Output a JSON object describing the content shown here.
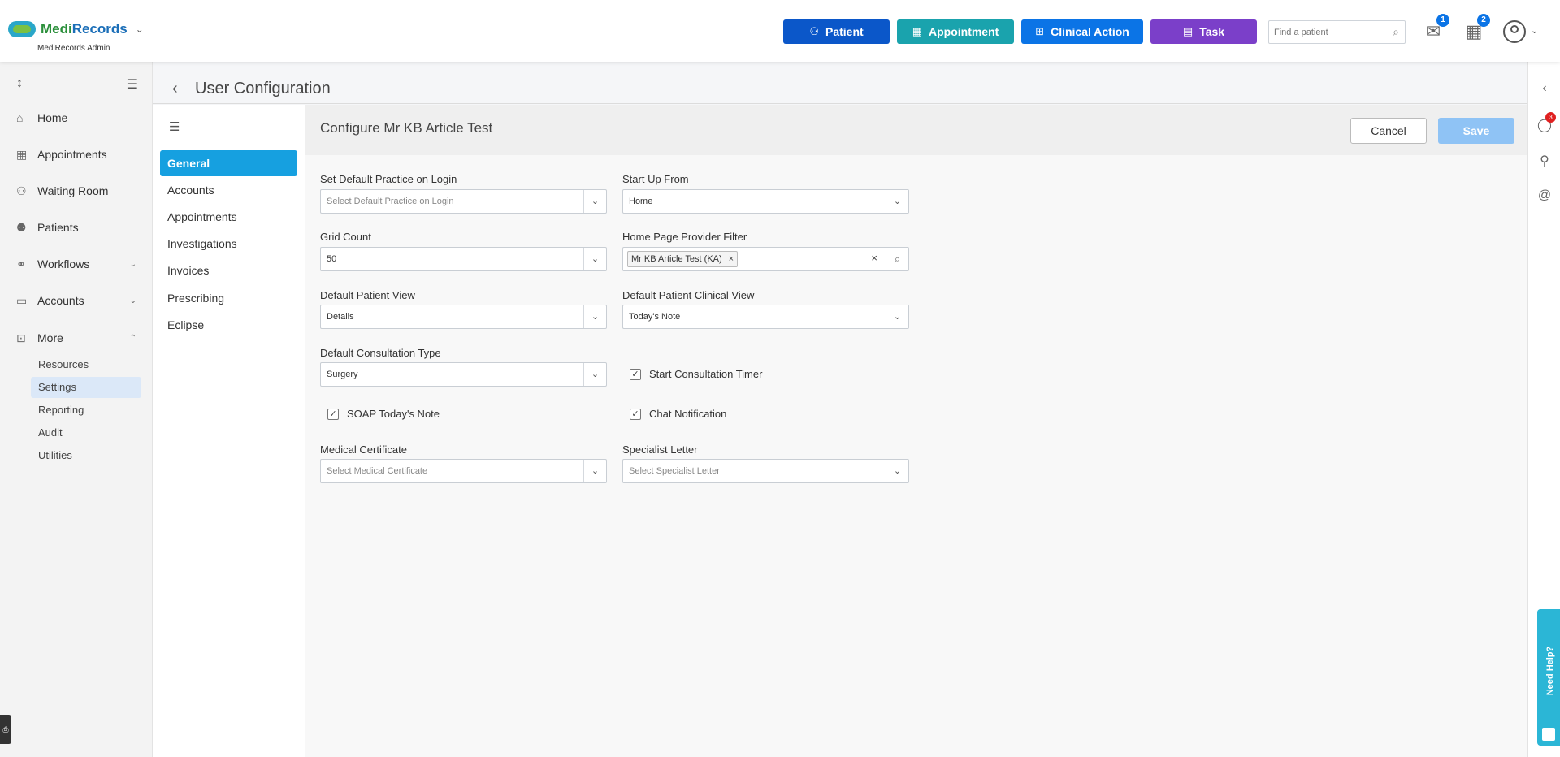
{
  "header": {
    "logo": {
      "part1": "Medi",
      "part2": "Records"
    },
    "role": "MediRecords Admin",
    "buttons": {
      "patient": "Patient",
      "appointment": "Appointment",
      "clinical_action": "Clinical Action",
      "task": "Task"
    },
    "search_placeholder": "Find a patient",
    "mail_count": "1",
    "task_count": "2"
  },
  "nav": {
    "items": [
      {
        "label": "Home",
        "icon": "home-icon"
      },
      {
        "label": "Appointments",
        "icon": "calendar-icon"
      },
      {
        "label": "Waiting Room",
        "icon": "waiting-room-icon"
      },
      {
        "label": "Patients",
        "icon": "patients-icon"
      },
      {
        "label": "Workflows",
        "icon": "workflows-icon"
      },
      {
        "label": "Accounts",
        "icon": "folder-icon"
      },
      {
        "label": "More",
        "icon": "more-icon"
      }
    ],
    "more_sub": [
      "Resources",
      "Settings",
      "Reporting",
      "Audit",
      "Utilities"
    ],
    "active_sub": "Settings"
  },
  "page": {
    "title": "User Configuration"
  },
  "subnav": {
    "items": [
      "General",
      "Accounts",
      "Appointments",
      "Investigations",
      "Invoices",
      "Prescribing",
      "Eclipse"
    ],
    "active": "General"
  },
  "form": {
    "title": "Configure Mr KB Article Test",
    "cancel": "Cancel",
    "save": "Save",
    "default_practice": {
      "label": "Set Default Practice on Login",
      "placeholder": "Select Default Practice on Login"
    },
    "startup": {
      "label": "Start Up From",
      "value": "Home"
    },
    "grid_count": {
      "label": "Grid Count",
      "value": "50"
    },
    "provider_filter": {
      "label": "Home Page Provider Filter",
      "chip": "Mr KB Article Test (KA)"
    },
    "patient_view": {
      "label": "Default Patient View",
      "value": "Details"
    },
    "clinical_view": {
      "label": "Default Patient Clinical View",
      "value": "Today's Note"
    },
    "consultation_type": {
      "label": "Default Consultation Type",
      "value": "Surgery"
    },
    "start_timer": {
      "label": "Start Consultation Timer",
      "checked": true
    },
    "soap_note": {
      "label": "SOAP Today's Note",
      "checked": true
    },
    "chat_notification": {
      "label": "Chat Notification",
      "checked": true
    },
    "medical_certificate": {
      "label": "Medical Certificate",
      "placeholder": "Select Medical Certificate"
    },
    "specialist_letter": {
      "label": "Specialist Letter",
      "placeholder": "Select Specialist Letter"
    }
  },
  "right_rail": {
    "chat_count": "3",
    "need_help": "Need Help?"
  },
  "colors": {
    "patient_btn": "#0b57c9",
    "appointment_btn": "#1aa3ad",
    "clinical_btn": "#0b74e6",
    "task_btn": "#7b3fc9",
    "active_tab": "#16a0e0",
    "save_disabled": "#8fc3f5"
  }
}
